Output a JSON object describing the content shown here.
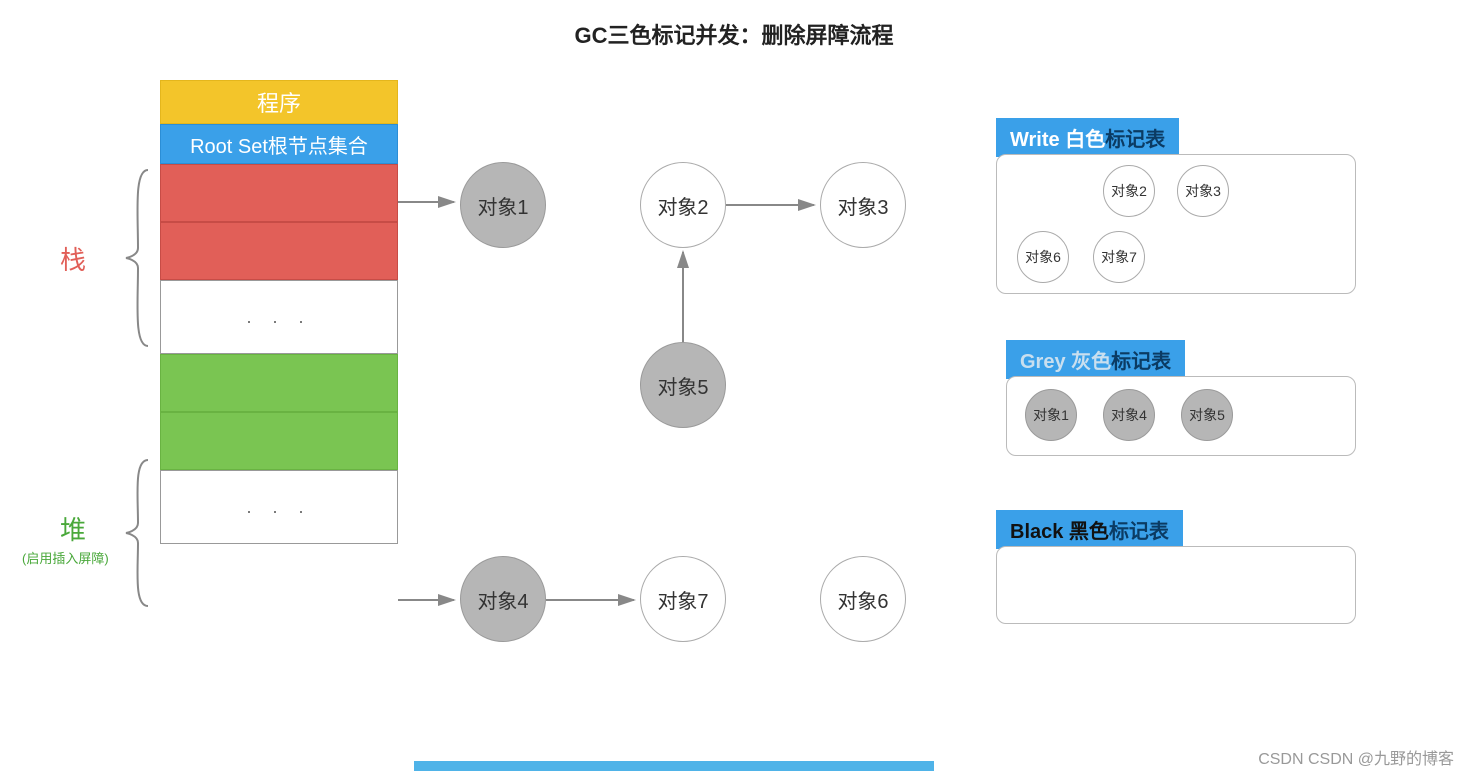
{
  "title": "GC三色标记并发：删除屏障流程",
  "left": {
    "stack_label": "栈",
    "heap_label": "堆",
    "heap_sub": "(启用插入屏障)"
  },
  "cells": {
    "program": "程序",
    "root": "Root Set根节点集合",
    "dots": ". . ."
  },
  "objects": {
    "o1": "对象1",
    "o2": "对象2",
    "o3": "对象3",
    "o4": "对象4",
    "o5": "对象5",
    "o6": "对象6",
    "o7": "对象7"
  },
  "tables": {
    "white": {
      "prefix": "Write 白色",
      "suffix": "标记表",
      "items": [
        "对象2",
        "对象3",
        "对象6",
        "对象7"
      ]
    },
    "grey": {
      "prefix": "Grey 灰色",
      "suffix": "标记表",
      "items": [
        "对象1",
        "对象4",
        "对象5"
      ]
    },
    "black": {
      "prefix": "Black 黑色",
      "suffix": "标记表",
      "items": []
    }
  },
  "watermark": "CSDN CSDN @九野的博客"
}
